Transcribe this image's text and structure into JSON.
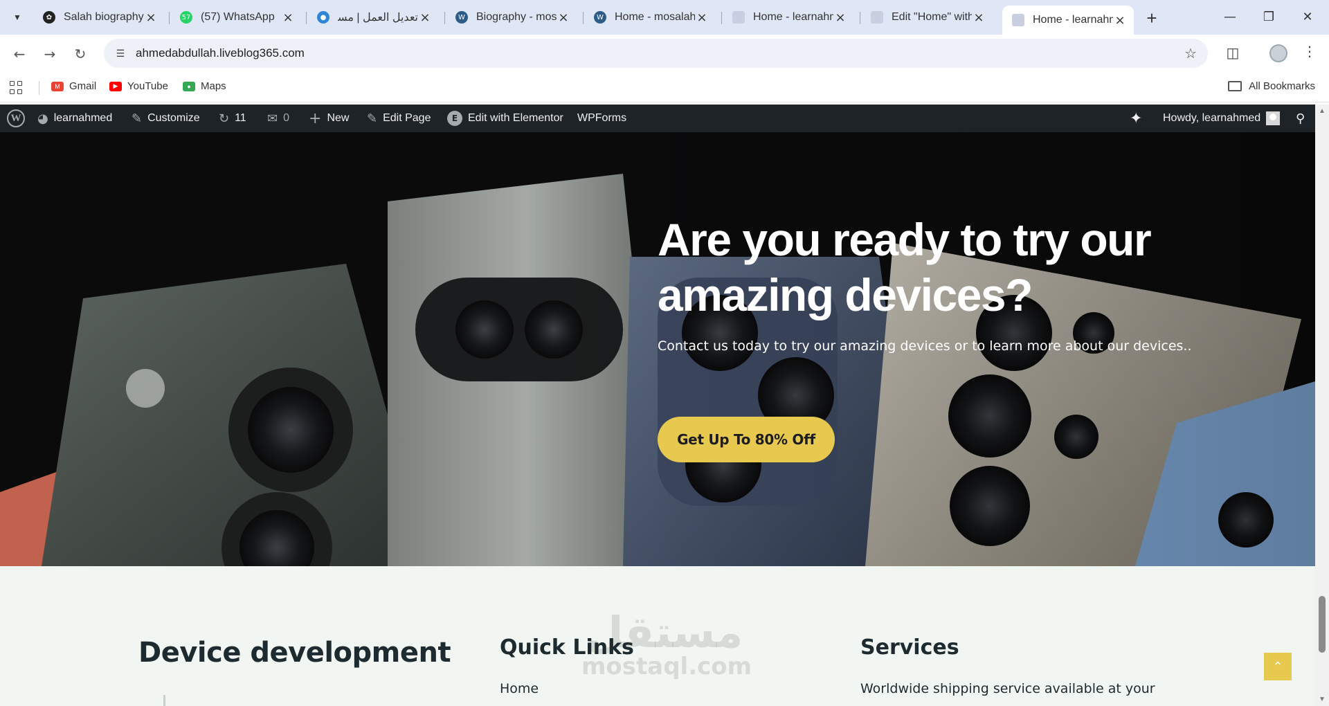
{
  "browser": {
    "tabs": [
      {
        "title": "Salah biography",
        "favicon": "chatgpt-icon",
        "color": "#222222"
      },
      {
        "title": "(57) WhatsApp",
        "favicon": "whatsapp-icon",
        "color": "#25d366",
        "badge": "57"
      },
      {
        "title": "تعديل العمل | مستقل",
        "favicon": "mostaql-icon",
        "color": "#2f86d8"
      },
      {
        "title": "Biography - mosalah",
        "favicon": "wordpress-icon",
        "color": "#2c5b8a"
      },
      {
        "title": "Home - mosalah",
        "favicon": "wordpress-icon",
        "color": "#2c5b8a"
      },
      {
        "title": "Home - learnahmed",
        "favicon": "page-icon",
        "color": "#c9cfe0"
      },
      {
        "title": "Edit \"Home\" with Elementor",
        "favicon": "page-icon",
        "color": "#c9cfe0"
      },
      {
        "title": "Home - learnahmed",
        "favicon": "page-icon",
        "color": "#c9cfe0",
        "active": true
      }
    ],
    "url": "ahmedabdullah.liveblog365.com",
    "bookmarks": [
      {
        "label": "Gmail",
        "icon": "gmail-icon",
        "color": "#ea4335"
      },
      {
        "label": "YouTube",
        "icon": "youtube-icon",
        "color": "#ff0000"
      },
      {
        "label": "Maps",
        "icon": "maps-icon",
        "color": "#34a853"
      }
    ],
    "all_bookmarks": "All Bookmarks"
  },
  "adminbar": {
    "site": "learnahmed",
    "customize": "Customize",
    "updates": "11",
    "comments": "0",
    "new": "New",
    "edit_page": "Edit Page",
    "elementor": "Edit with Elementor",
    "wpforms": "WPForms",
    "howdy": "Howdy, learnahmed"
  },
  "hero": {
    "title": "Are you ready to try our amazing devices?",
    "subtitle": "Contact us today to try our amazing devices or to learn more about our devices..",
    "cta": "Get Up To 80% Off"
  },
  "footer": {
    "brand": "Device development",
    "quick_links_title": "Quick Links",
    "quick_link_first": "Home",
    "services_title": "Services",
    "services_text": "Worldwide shipping service available at your"
  },
  "watermark": {
    "arabic": "مستقل",
    "latin": "mostaql.com"
  },
  "colors": {
    "accent": "#e8c94f",
    "adminbar": "#1d2327",
    "footer_bg": "#f1f6f2"
  }
}
